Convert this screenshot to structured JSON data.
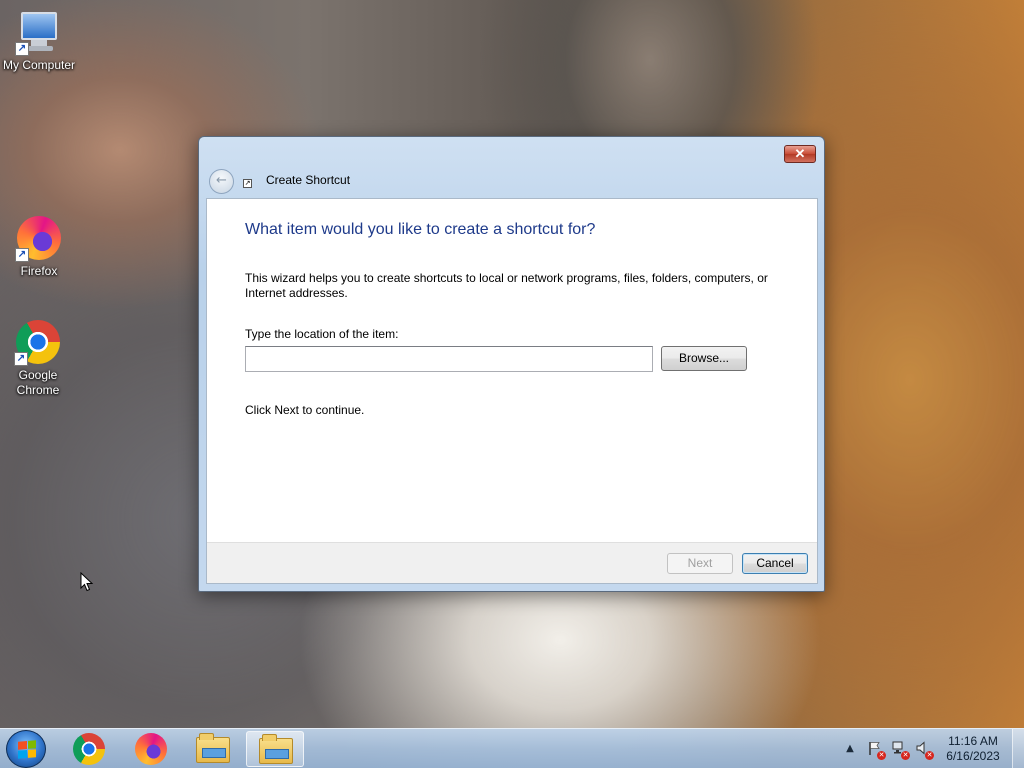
{
  "desktop": {
    "icons": [
      {
        "label": "My Computer",
        "icon": "monitor-icon"
      },
      {
        "label": "Firefox",
        "icon": "firefox-icon"
      },
      {
        "label": "Google Chrome",
        "icon": "chrome-icon"
      }
    ]
  },
  "dialog": {
    "title": "Create Shortcut",
    "close_glyph": "✕",
    "back_glyph": "←",
    "heading": "What item would you like to create a shortcut for?",
    "description": "This wizard helps you to create shortcuts to local or network programs, files, folders, computers, or Internet addresses.",
    "location_label": "Type the location of the item:",
    "location_value": "",
    "browse_label": "Browse...",
    "continue_text": "Click Next to continue.",
    "next_label": "Next",
    "cancel_label": "Cancel"
  },
  "taskbar": {
    "items": [
      "start-icon",
      "chrome-icon",
      "firefox-icon",
      "explorer-icon",
      "explorer-icon"
    ],
    "tray": {
      "show_hidden_glyph": "▲",
      "clock_time": "11:16 AM",
      "clock_date": "6/16/2023"
    }
  },
  "colors": {
    "heading": "#1e3a8a",
    "close_button": "#c84b35"
  }
}
